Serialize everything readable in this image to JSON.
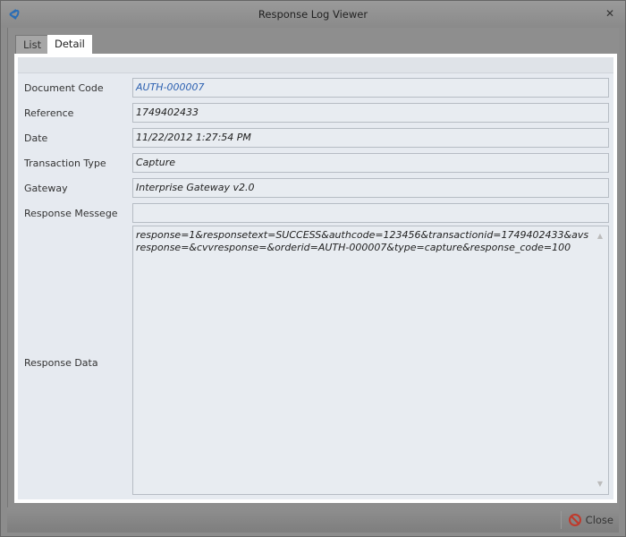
{
  "window": {
    "title": "Response Log Viewer"
  },
  "tabs": [
    {
      "label": "List"
    },
    {
      "label": "Detail"
    }
  ],
  "fields": [
    {
      "label": "Document Code",
      "value": "AUTH-000007"
    },
    {
      "label": "Reference",
      "value": "1749402433"
    },
    {
      "label": "Date",
      "value": "11/22/2012 1:27:54 PM"
    },
    {
      "label": "Transaction Type",
      "value": "Capture"
    },
    {
      "label": "Gateway",
      "value": "Interprise Gateway v2.0"
    },
    {
      "label": "Response Messege",
      "value": ""
    }
  ],
  "response_data": {
    "label": "Response Data",
    "value": "response=1&responsetext=SUCCESS&authcode=123456&transactionid=1749402433&avsresponse=&cvvresponse=&orderid=AUTH-000007&type=capture&response_code=100"
  },
  "footer": {
    "close_label": "Close"
  }
}
